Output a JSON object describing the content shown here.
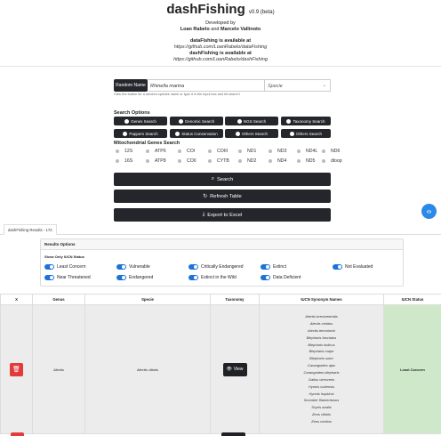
{
  "header": {
    "title": "dashFishing",
    "version": "v0.9 (beta)",
    "developed_by": "Developed by",
    "authors_a": "Loan Rabelo",
    "authors_and": "and",
    "authors_b": "Marcelo Vallinoto",
    "avail1": "dataFishing is available at",
    "url1": "https://github.com/LoanRabelo/dataFishing",
    "avail2": "dashFishing is available at",
    "url2": "https://github.com/LoanRabelo/dashFishing"
  },
  "random": {
    "button": "Random Name",
    "input_value": "Rhinella marina",
    "select_value": "Specie",
    "hint": "Click the button for a random species name or type it in the input box and hit search!"
  },
  "search_options": {
    "title": "Search Options",
    "options": [
      "Genes Search",
      "Genomic Search",
      "NGS Search",
      "Taxonomy Search",
      "Pappers Search",
      "Status Conservation",
      "Others Search",
      "Others Search"
    ]
  },
  "mito": {
    "title": "Mitochondrial Genes Search",
    "genes_row1": [
      "12S",
      "ATP6",
      "COI",
      "COIII",
      "ND1",
      "ND3",
      "ND4L",
      "ND6"
    ],
    "genes_row2": [
      "16S",
      "ATP8",
      "COII",
      "CYTB",
      "ND2",
      "ND4",
      "ND5",
      "dloop"
    ]
  },
  "actions": {
    "search": "Search",
    "refresh": "Refresh Table",
    "export": "Export to Excel"
  },
  "tab": {
    "label": "dashFishing Results - 172"
  },
  "results": {
    "title": "Results Options",
    "only_label": "Show Only IUCN Status",
    "statuses": [
      "Least Concern",
      "Vulnerable",
      "Critically Endangered",
      "Extinct",
      "Not Evaluated",
      "Near Threatened",
      "Endangered",
      "Extinct in the Wild",
      "Data Deficient"
    ]
  },
  "table": {
    "headers": [
      "X",
      "Genus",
      "Specie",
      "Taxonomy",
      "IUCN Synonym Names",
      "IUCN Status"
    ],
    "row": {
      "genus": "Alectis",
      "specie": "Alectis ciliaris",
      "view": "View",
      "status": "Least Concern",
      "synonyms": [
        "Alectis breviventralis",
        "Alectis crinitus",
        "Alectis temmincki",
        "Blepharis fasciatus",
        "Blepharis indicus",
        "Blepharis major",
        "Blepharis sutor",
        "Caranguides ajax",
        "Carangoides blepharis",
        "Gallus virescens",
        "Hynnis cubensis",
        "Hynnis hopkinsi",
        "Scomber filamentosus",
        "Scyris analis",
        "Zeus ciliaris",
        "Zeus crinitus"
      ]
    }
  },
  "colors": {
    "accent": "#2b8ae6",
    "dark": "#24262b",
    "danger": "#e23b3b",
    "success_bg": "#cfe8c9"
  }
}
